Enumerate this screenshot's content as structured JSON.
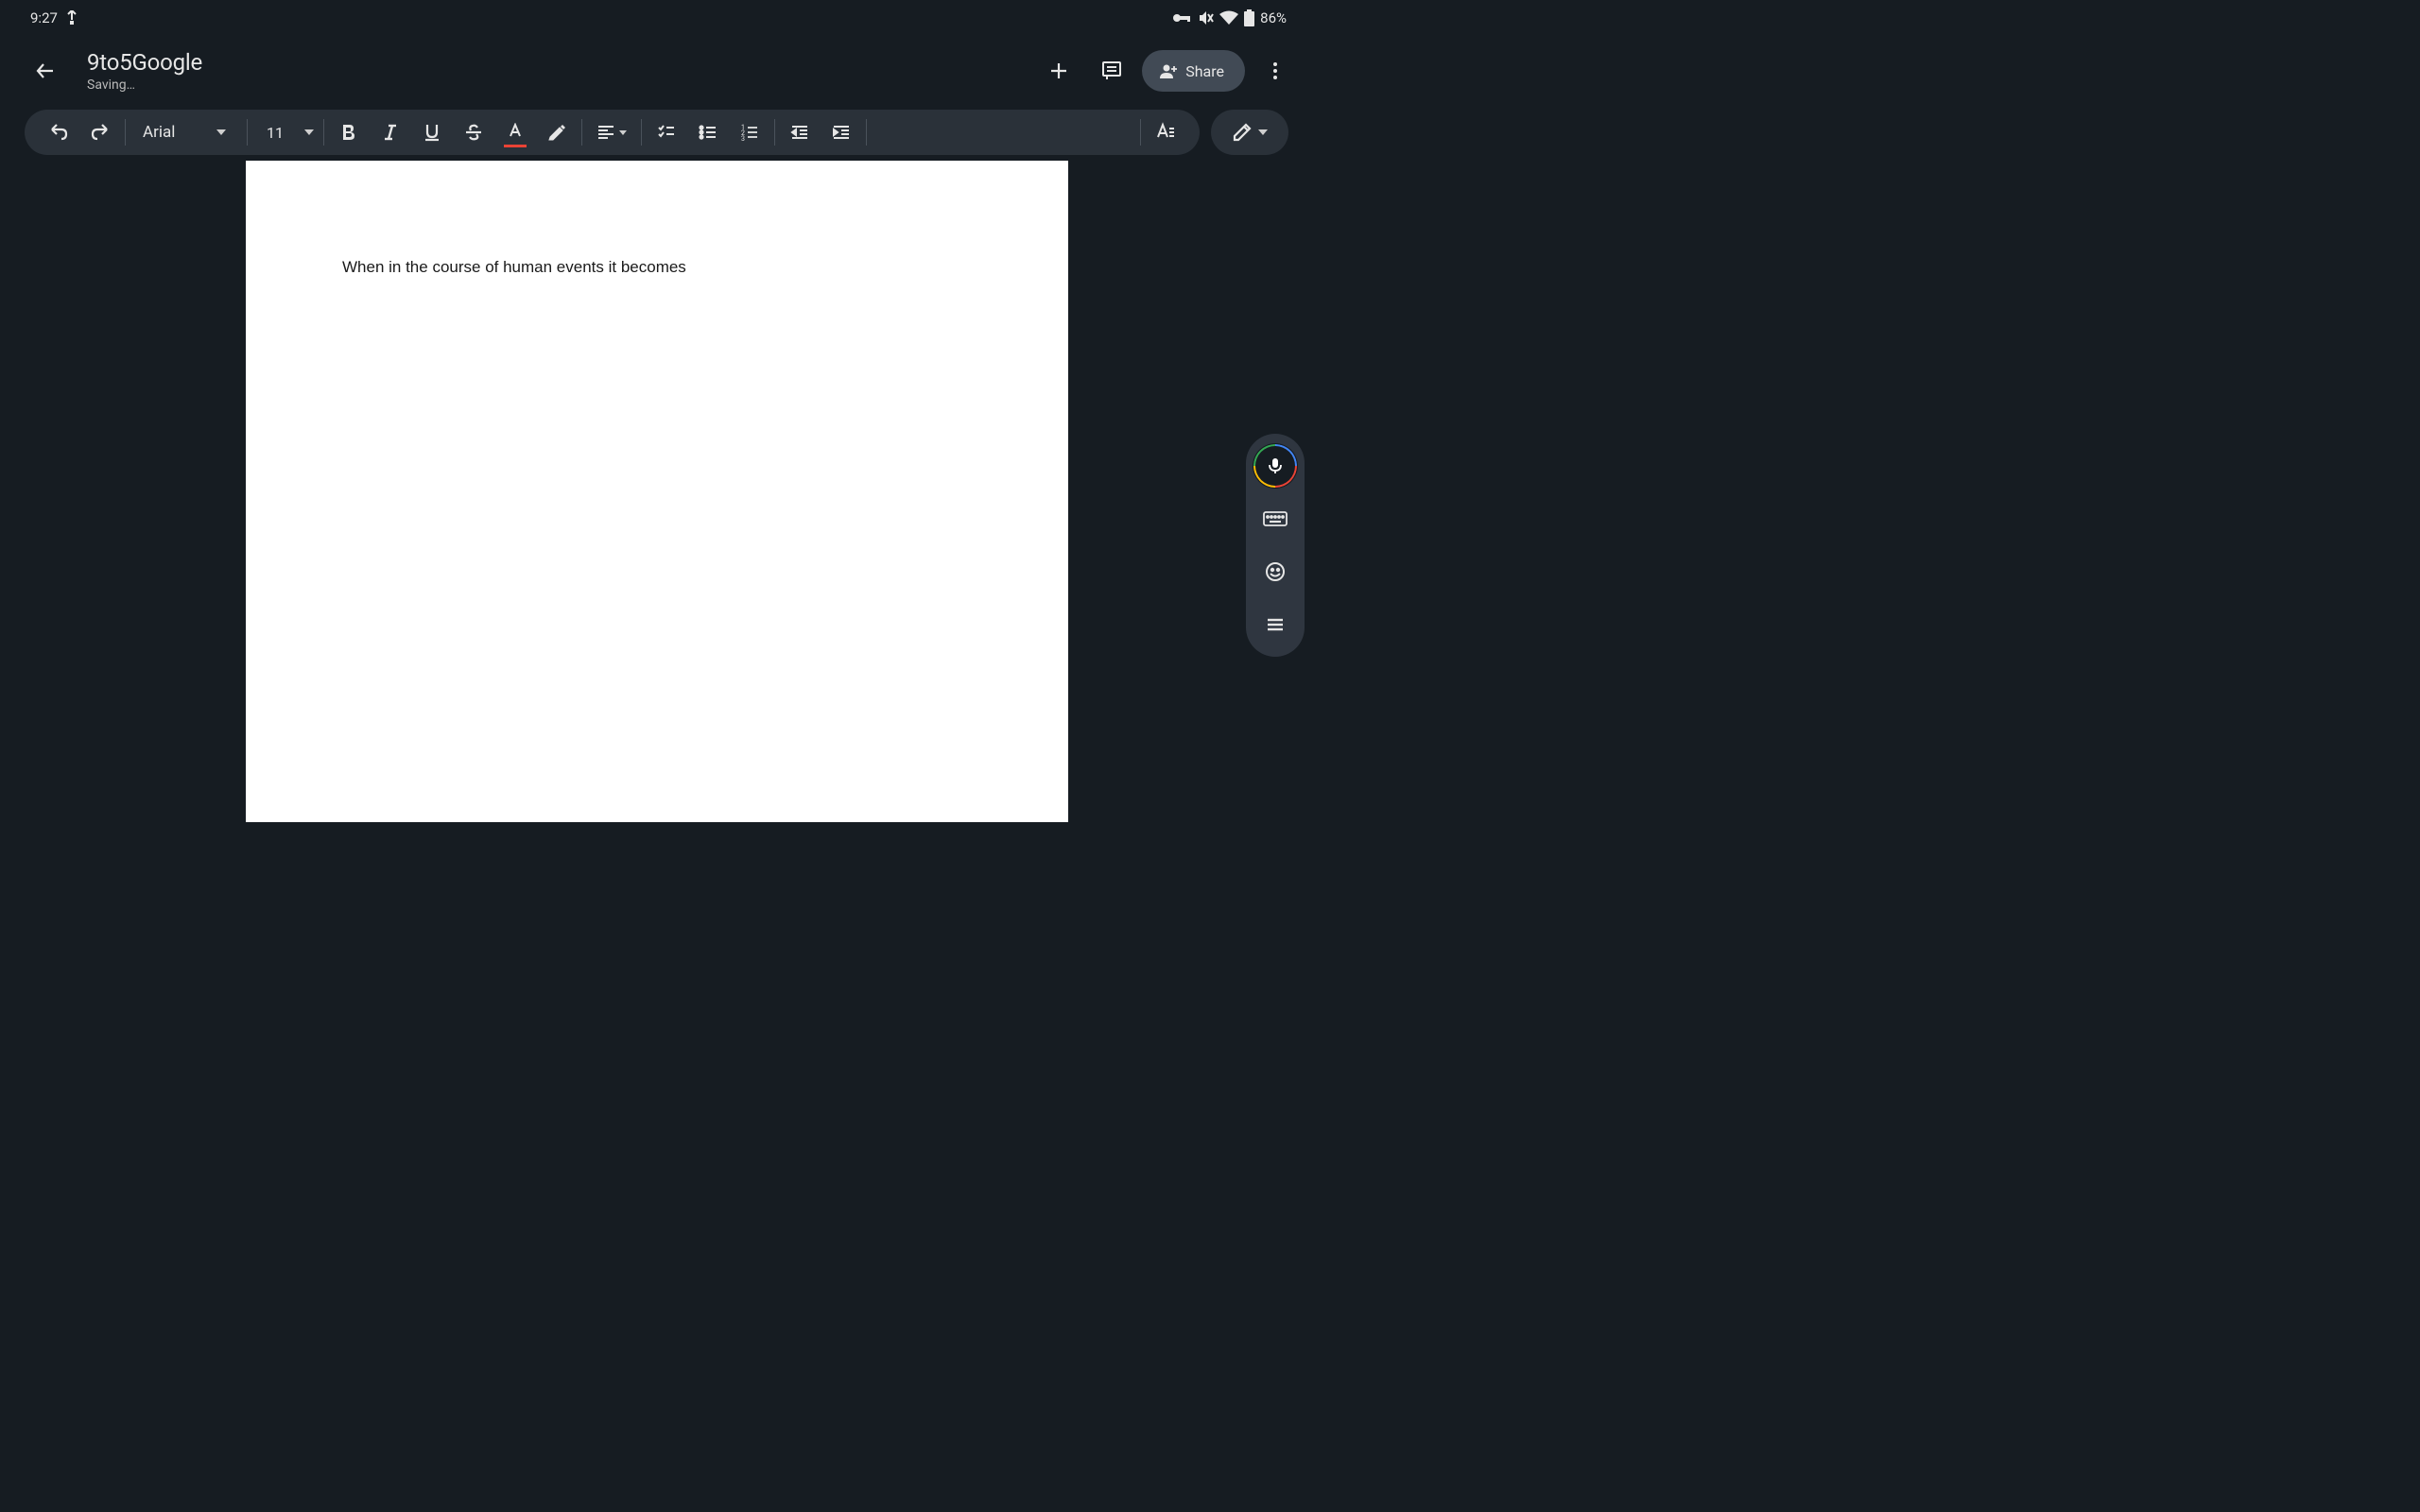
{
  "status_bar": {
    "time": "9:27",
    "battery_pct": "86%"
  },
  "header": {
    "title": "9to5Google",
    "save_status": "Saving…",
    "share_label": "Share"
  },
  "toolbar": {
    "font_name": "Arial",
    "font_size": "11"
  },
  "document": {
    "body_text": "When in the course of human events it becomes"
  }
}
